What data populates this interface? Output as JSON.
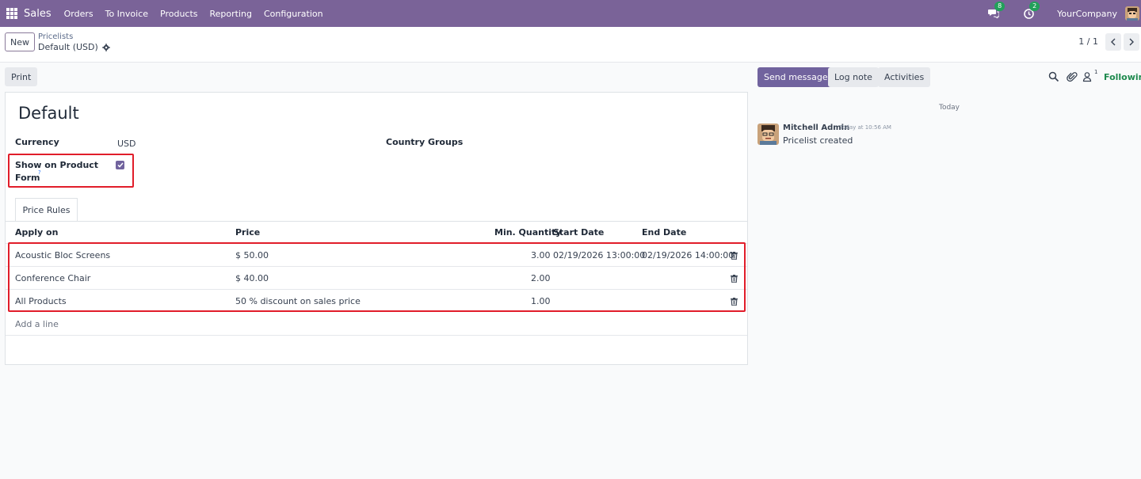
{
  "navbar": {
    "app_name": "Sales",
    "menu": [
      "Orders",
      "To Invoice",
      "Products",
      "Reporting",
      "Configuration"
    ],
    "messages_badge": "8",
    "activities_badge": "2",
    "company": "YourCompany"
  },
  "control_panel": {
    "new_label": "New",
    "breadcrumb_parent": "Pricelists",
    "breadcrumb_current": "Default (USD)",
    "pager": "1 / 1"
  },
  "actions": {
    "print_label": "Print"
  },
  "form": {
    "title": "Default",
    "currency_label": "Currency",
    "currency_value": "USD",
    "country_groups_label": "Country Groups",
    "show_on_product_form_label_1": "Show on Product",
    "show_on_product_form_label_2": "Form",
    "help_mark": "?",
    "show_on_product_form_checked": true,
    "tab_label": "Price Rules",
    "columns": [
      "Apply on",
      "Price",
      "Min. Quantity",
      "Start Date",
      "End Date"
    ],
    "rows": [
      {
        "apply_on": "Acoustic Bloc Screens",
        "price": "$ 50.00",
        "min_qty": "3.00",
        "start_date": "02/19/2026 13:00:00",
        "end_date": "02/19/2026 14:00:00"
      },
      {
        "apply_on": "Conference Chair",
        "price": "$ 40.00",
        "min_qty": "2.00",
        "start_date": "",
        "end_date": ""
      },
      {
        "apply_on": "All Products",
        "price": "50 % discount on sales price",
        "min_qty": "1.00",
        "start_date": "",
        "end_date": ""
      }
    ],
    "add_line_label": "Add a line"
  },
  "chatter": {
    "send_message_label": "Send message",
    "log_note_label": "Log note",
    "activities_label": "Activities",
    "followers_count": "1",
    "following_label": "Following",
    "date_separator": "Today",
    "messages": [
      {
        "author": "Mitchell Admin",
        "time": "Today at 10:56 AM",
        "body": "Pricelist created"
      }
    ]
  },
  "colors": {
    "navbar": "#7a6398",
    "primary": "#71639e",
    "highlight": "#e11d2a",
    "following": "#1e8a4e"
  }
}
